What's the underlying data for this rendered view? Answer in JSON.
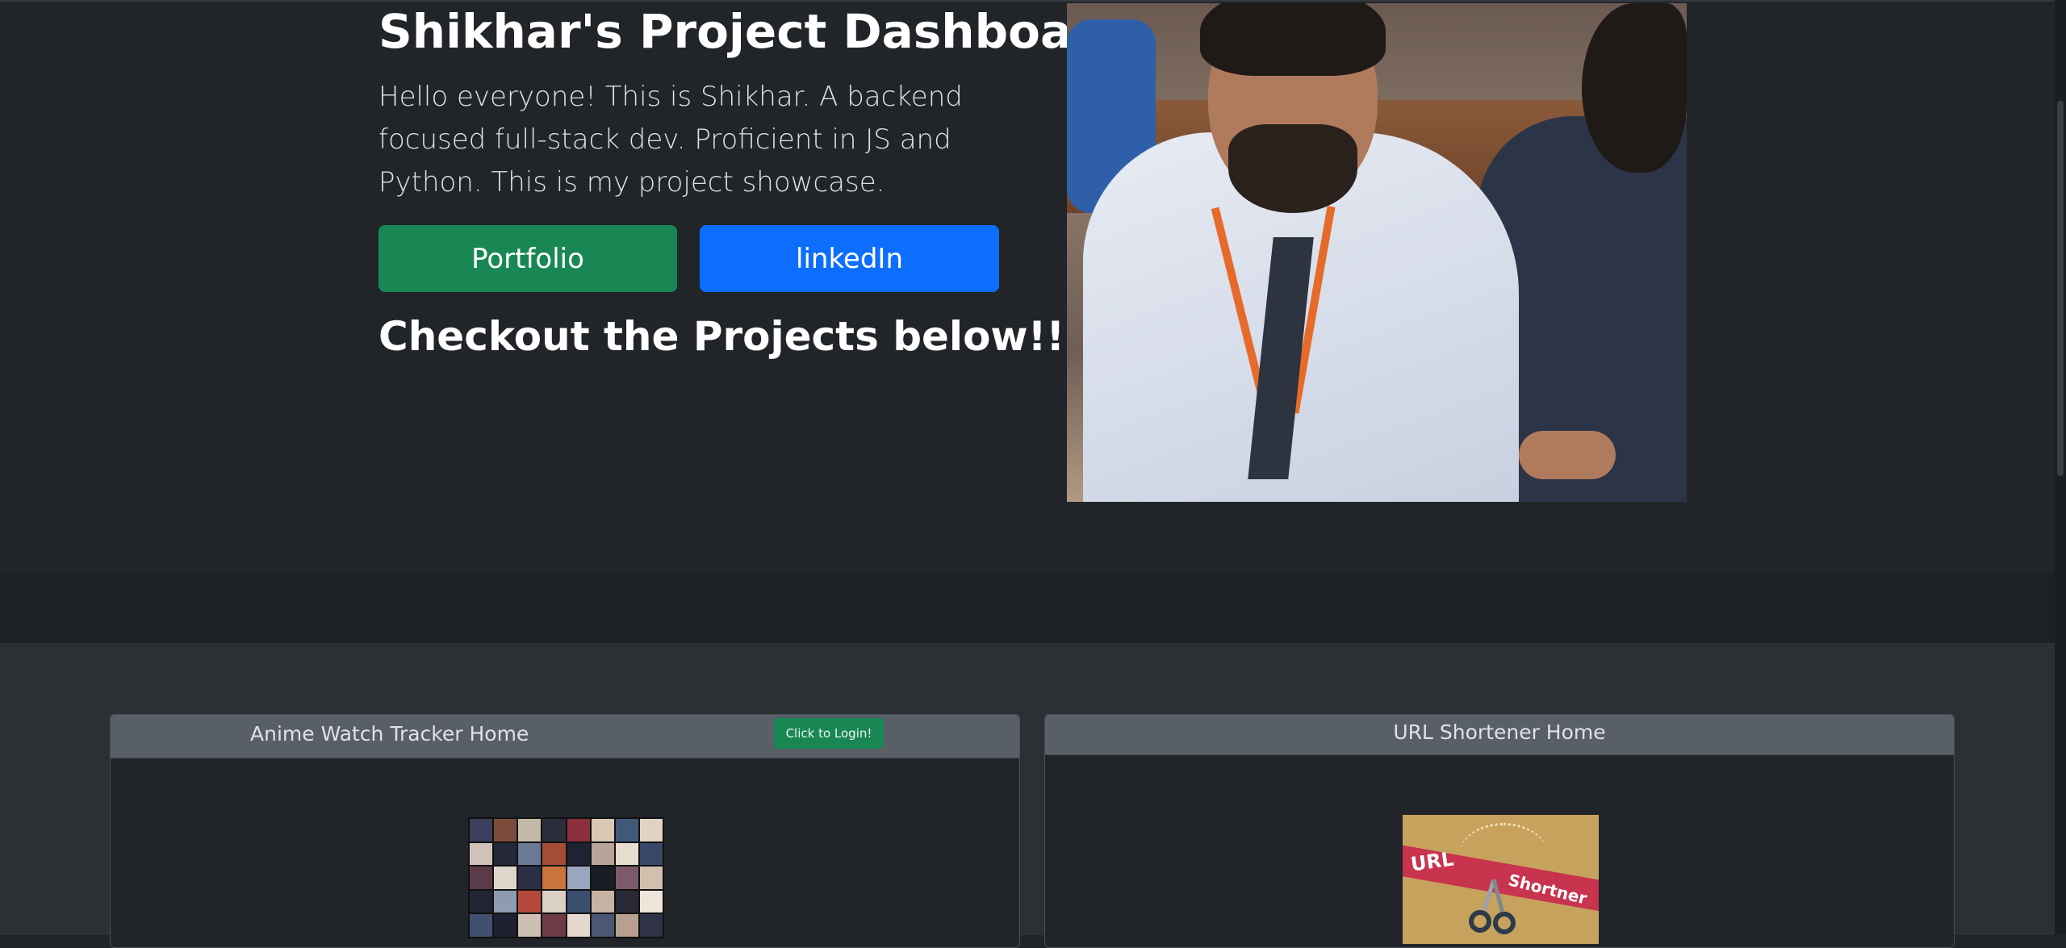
{
  "hero": {
    "title": "Shikhar's Project Dashboard",
    "lead": "Hello everyone! This is Shikhar. A backend focused full-stack dev. Proficient in JS and Python. This is my project showcase.",
    "buttons": {
      "portfolio": "Portfolio",
      "linkedin": "linkedIn"
    },
    "subheading": "Checkout the Projects below!!!",
    "photo_icon": "profile-photo"
  },
  "projects": [
    {
      "title": "Anime Watch Tracker Home",
      "action_label": "Click to Login!",
      "thumbnail_icon": "anime-collage-thumbnail"
    },
    {
      "title": "URL Shortener Home",
      "thumbnail_icon": "url-shortener-logo",
      "thumbnail_text": [
        "URL",
        "Shortner"
      ]
    }
  ],
  "colors": {
    "background": "#212529",
    "success": "#198754",
    "primary": "#0d6efd",
    "card_header": "#585f66"
  }
}
